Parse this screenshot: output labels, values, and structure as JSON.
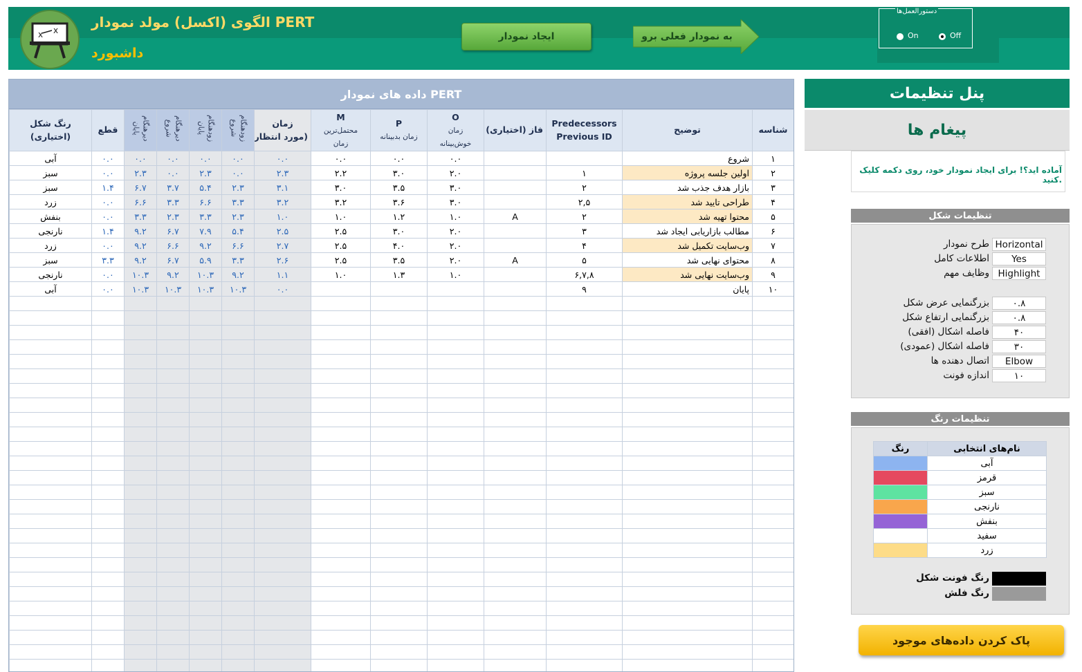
{
  "header": {
    "title": "الگوی (اکسل) مولد نمودار PERT",
    "subtitle": "داشبورد",
    "create_button": "ایجاد نمودار",
    "goto_button": "به نمودار فعلی برو",
    "guide": {
      "legend": "دستورالعمل‌ها",
      "on": "On",
      "off": "Off",
      "selected": "Off"
    }
  },
  "data_table": {
    "title": "داده های نمودار PERT",
    "columns": {
      "id": "شناسه",
      "description": "توضیح",
      "predecessors": "Predecessors",
      "predecessors_sub": "Previous ID",
      "phase": "فاز (اختیاری)",
      "o": "O",
      "o_sub1": "زمان",
      "o_sub2": "خوش‌بینانه",
      "p": "P",
      "p_sub": "زمان بدبینانه",
      "m": "M",
      "m_sub1": "محتمل‌ترین",
      "m_sub2": "زمان",
      "expected1": "زمان",
      "expected2": "(مورد انتظار)",
      "early_start1": "شروع",
      "early_start2": "زودهنگام",
      "early_finish1": "پایان",
      "early_finish2": "زودهنگام",
      "late_start1": "شروع",
      "late_start2": "دیرهنگام",
      "late_finish1": "پایان",
      "late_finish2": "دیرهنگام",
      "critical": "قطع",
      "color1": "رنگ شکل",
      "color2": "(اختیاری)"
    },
    "rows": [
      {
        "id": "۱",
        "desc": "شروع",
        "hl": false,
        "pred": "",
        "phase": "",
        "o": "۰.۰",
        "p": "۰.۰",
        "m": "۰.۰",
        "te": "۰.۰",
        "es": "۰.۰",
        "ef": "۰.۰",
        "ls": "۰.۰",
        "lf": "۰.۰",
        "slack": "۰.۰",
        "color": "آبی"
      },
      {
        "id": "۲",
        "desc": "اولین جلسه پروژه",
        "hl": true,
        "pred": "۱",
        "phase": "",
        "o": "۲.۰",
        "p": "۳.۰",
        "m": "۲.۲",
        "te": "۲.۳",
        "es": "۰.۰",
        "ef": "۲.۳",
        "ls": "۰.۰",
        "lf": "۲.۳",
        "slack": "۰.۰",
        "color": "سبز"
      },
      {
        "id": "۳",
        "desc": "بازار هدف جذب شد",
        "hl": false,
        "pred": "۲",
        "phase": "",
        "o": "۳.۰",
        "p": "۳.۵",
        "m": "۳.۰",
        "te": "۳.۱",
        "es": "۲.۳",
        "ef": "۵.۴",
        "ls": "۳.۷",
        "lf": "۶.۷",
        "slack": "۱.۴",
        "color": "سبز"
      },
      {
        "id": "۴",
        "desc": "طراحی تایید شد",
        "hl": true,
        "pred": "۲,۵",
        "phase": "",
        "o": "۳.۰",
        "p": "۳.۶",
        "m": "۳.۲",
        "te": "۳.۲",
        "es": "۳.۳",
        "ef": "۶.۶",
        "ls": "۳.۳",
        "lf": "۶.۶",
        "slack": "۰.۰",
        "color": "زرد"
      },
      {
        "id": "۵",
        "desc": "محتوا تهیه شد",
        "hl": true,
        "pred": "۲",
        "phase": "A",
        "o": "۱.۰",
        "p": "۱.۲",
        "m": "۱.۰",
        "te": "۱.۰",
        "es": "۲.۳",
        "ef": "۳.۳",
        "ls": "۲.۳",
        "lf": "۳.۳",
        "slack": "۰.۰",
        "color": "بنفش"
      },
      {
        "id": "۶",
        "desc": "مطالب بازاریابی ایجاد شد",
        "hl": false,
        "pred": "۳",
        "phase": "",
        "o": "۲.۰",
        "p": "۳.۰",
        "m": "۲.۵",
        "te": "۲.۵",
        "es": "۵.۴",
        "ef": "۷.۹",
        "ls": "۶.۷",
        "lf": "۹.۲",
        "slack": "۱.۴",
        "color": "نارنجی"
      },
      {
        "id": "۷",
        "desc": "وب‌سایت تکمیل شد",
        "hl": true,
        "pred": "۴",
        "phase": "",
        "o": "۲.۰",
        "p": "۴.۰",
        "m": "۲.۵",
        "te": "۲.۷",
        "es": "۶.۶",
        "ef": "۹.۲",
        "ls": "۶.۶",
        "lf": "۹.۲",
        "slack": "۰.۰",
        "color": "زرد"
      },
      {
        "id": "۸",
        "desc": "محتوای نهایی شد",
        "hl": false,
        "pred": "۵",
        "phase": "A",
        "o": "۲.۰",
        "p": "۳.۵",
        "m": "۲.۵",
        "te": "۲.۶",
        "es": "۳.۳",
        "ef": "۵.۹",
        "ls": "۶.۷",
        "lf": "۹.۲",
        "slack": "۳.۳",
        "color": "سبز"
      },
      {
        "id": "۹",
        "desc": "وب‌سایت نهایی شد",
        "hl": true,
        "pred": "۶,۷,۸",
        "phase": "",
        "o": "۱.۰",
        "p": "۱.۳",
        "m": "۱.۰",
        "te": "۱.۱",
        "es": "۹.۲",
        "ef": "۱۰.۳",
        "ls": "۹.۲",
        "lf": "۱۰.۳",
        "slack": "۰.۰",
        "color": "نارنجی"
      },
      {
        "id": "۱۰",
        "desc": "پایان",
        "hl": false,
        "pred": "۹",
        "phase": "",
        "o": "",
        "p": "",
        "m": "",
        "te": "۰.۰",
        "es": "۱۰.۳",
        "ef": "۱۰.۳",
        "ls": "۱۰.۳",
        "lf": "۱۰.۳",
        "slack": "۰.۰",
        "color": "آبی"
      }
    ]
  },
  "panel": {
    "title": "پنل تنظیمات",
    "messages_title": "پیغام ها",
    "message": "آماده اید؟! برای ایجاد نمودار خود، روی دکمه کلیک کنید.",
    "shape_settings_title": "تنظیمات شکل",
    "shape_settings": [
      {
        "label": "طرح نمودار",
        "value": "Horizontal"
      },
      {
        "label": "اطلاعات کامل",
        "value": "Yes"
      },
      {
        "label": "وظایف مهم",
        "value": "Highlight"
      }
    ],
    "size_settings": [
      {
        "label": "بزرگنمایی عرض شکل",
        "value": "۰.۸"
      },
      {
        "label": "بزرگنمایی ارتفاع شکل",
        "value": "۰.۸"
      },
      {
        "label": "فاصله اشکال (افقی)",
        "value": "۴۰"
      },
      {
        "label": "فاصله اشکال (عمودی)",
        "value": "۳۰"
      },
      {
        "label": "اتصال دهنده ها",
        "value": "Elbow"
      },
      {
        "label": "اندازه فونت",
        "value": "۱۰"
      }
    ],
    "color_settings_title": "تنظیمات رنگ",
    "color_table": {
      "col_color": "رنگ",
      "col_names": "نام‌های انتخابی",
      "rows": [
        {
          "name": "آبی",
          "hex": "#8db4f0"
        },
        {
          "name": "قرمز",
          "hex": "#e5495f"
        },
        {
          "name": "سبز",
          "hex": "#5ee3a1"
        },
        {
          "name": "نارنجی",
          "hex": "#f9a64c"
        },
        {
          "name": "بنفش",
          "hex": "#9563d6"
        },
        {
          "name": "سفید",
          "hex": "#ffffff"
        },
        {
          "name": "زرد",
          "hex": "#fddc88"
        }
      ]
    },
    "font_color_label": "رنگ فونت شکل",
    "font_color_hex": "#000000",
    "arrow_color_label": "رنگ فلش",
    "arrow_color_hex": "#9a9a9a",
    "clear_button": "پاک کردن داده‌های موجود"
  }
}
